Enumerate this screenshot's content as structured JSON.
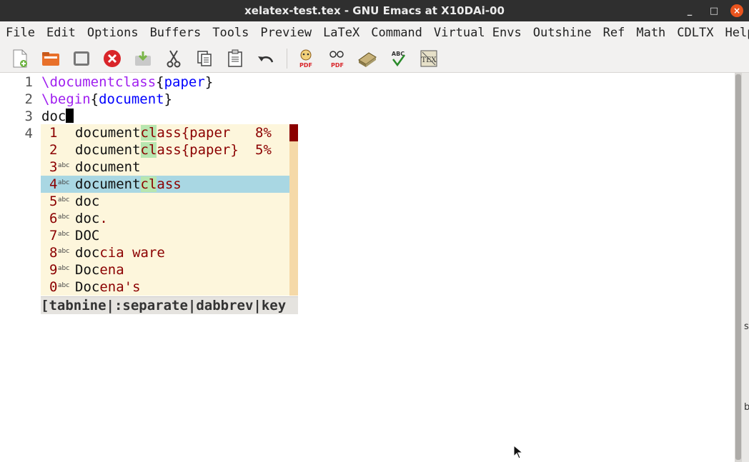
{
  "window": {
    "title": "xelatex-test.tex - GNU Emacs at X10DAi-00",
    "minimize": "_",
    "maximize": "□",
    "close": "×"
  },
  "menu": [
    "File",
    "Edit",
    "Options",
    "Buffers",
    "Tools",
    "Preview",
    "LaTeX",
    "Command",
    "Virtual Envs",
    "Outshine",
    "Ref",
    "Math",
    "CDLTX",
    "Help"
  ],
  "toolbar": {
    "icons": [
      "new-file-icon",
      "open-folder-icon",
      "dired-icon",
      "close-buffer-icon",
      "save-icon",
      "cut-icon",
      "copy-icon",
      "paste-icon",
      "undo-icon",
      "latex-pdf-icon",
      "view-pdf-icon",
      "bibtex-icon",
      "spell-check-icon",
      "tex-clean-icon"
    ],
    "icon_labels": {
      "latex_pdf": "PDF",
      "view_pdf": "PDF",
      "spell_check": "ABC",
      "tex_clean": "TEX"
    }
  },
  "editor": {
    "line_numbers": [
      "1",
      "2",
      "3",
      "4"
    ],
    "lines": [
      {
        "cmd": "\\documentclass",
        "open": "{",
        "arg": "paper",
        "close": "}"
      },
      {
        "cmd": "\\begin",
        "open": "{",
        "arg": "document",
        "close": "}"
      },
      {
        "text": "doc"
      },
      {
        "text": ""
      }
    ]
  },
  "completion": {
    "selected_index": 3,
    "candidates": [
      {
        "num": "1",
        "source": "",
        "prefix": "document",
        "hl": "cl",
        "rest": "ass{paper",
        "pct": "8%"
      },
      {
        "num": "2",
        "source": "",
        "prefix": "document",
        "hl": "cl",
        "rest": "ass{paper}",
        "pct": "5%"
      },
      {
        "num": "3",
        "source": "abc",
        "prefix": "document",
        "hl": "",
        "rest": "",
        "pct": ""
      },
      {
        "num": "4",
        "source": "abc",
        "prefix": "document",
        "hl": "cl",
        "rest": "ass",
        "pct": ""
      },
      {
        "num": "5",
        "source": "abc",
        "prefix": "doc",
        "hl": "",
        "rest": "",
        "pct": ""
      },
      {
        "num": "6",
        "source": "abc",
        "prefix": "doc",
        "hl": "",
        "rest": ".",
        "pct": ""
      },
      {
        "num": "7",
        "source": "abc",
        "prefix": "DOC",
        "hl": "",
        "rest": "",
        "pct": ""
      },
      {
        "num": "8",
        "source": "abc",
        "prefix": "doc",
        "hl": "",
        "rest": "cia ware",
        "pct": ""
      },
      {
        "num": "9",
        "source": "abc",
        "prefix": "Doc",
        "hl": "",
        "rest": "ena",
        "pct": ""
      },
      {
        "num": "0",
        "source": "abc",
        "prefix": "Doc",
        "hl": "",
        "rest": "ena's",
        "pct": ""
      }
    ],
    "footer": "[tabnine|:separate|dabbrev|key"
  },
  "right_strip_chars": [
    "s",
    "b"
  ],
  "colors": {
    "titlebar": "#2f2f2f",
    "close_button": "#e9541e",
    "keyword": "#a020f0",
    "argument": "#0000ff",
    "candidate_text": "#8b0000",
    "selection": "#a9d7e3",
    "match_highlight": "#b8e6b0",
    "popup_bg": "#fdf6dc"
  }
}
